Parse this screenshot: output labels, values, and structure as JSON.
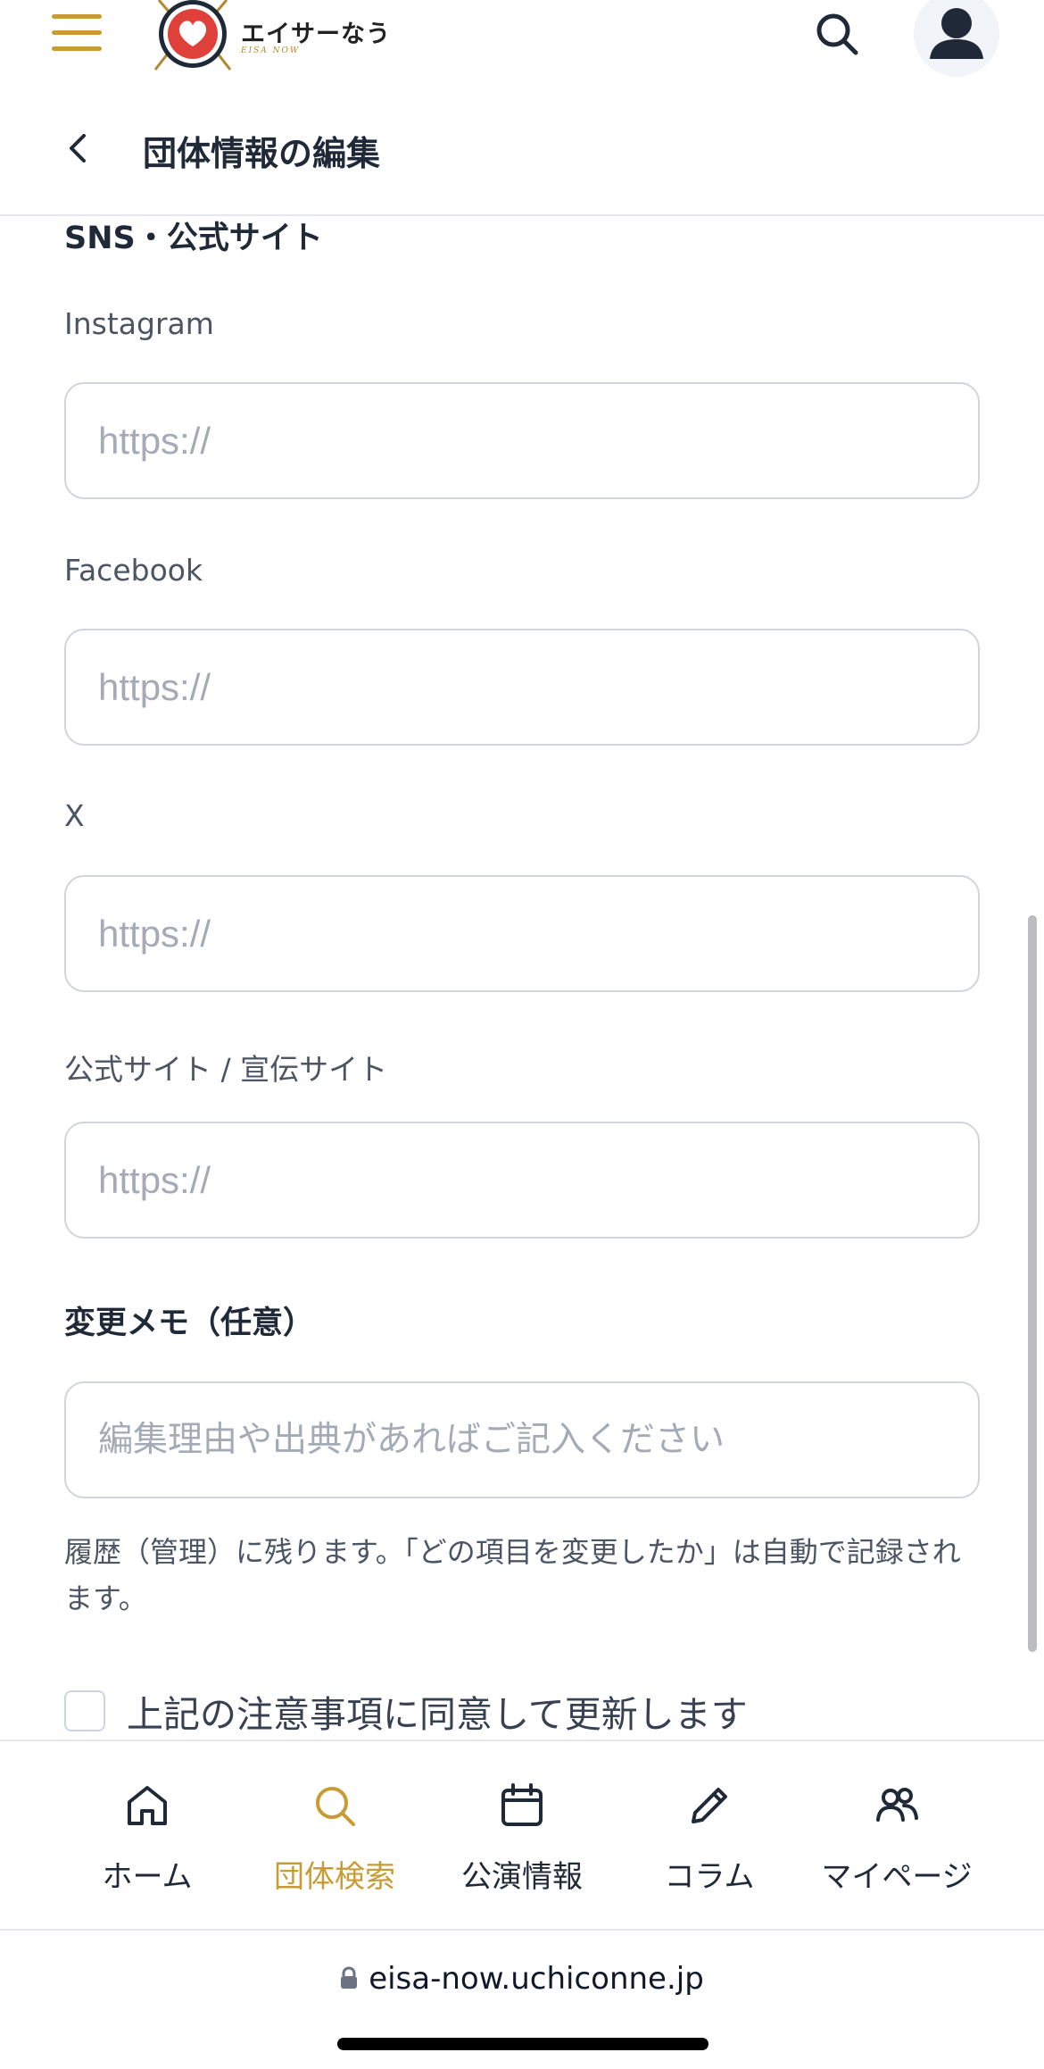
{
  "header": {
    "logo_title": "エイサーなう",
    "logo_subtitle": "EISA NOW",
    "page_title": "団体情報の編集"
  },
  "form": {
    "section_title": "SNS・公式サイト",
    "fields": [
      {
        "label": "Instagram",
        "value": "",
        "placeholder": "https://"
      },
      {
        "label": "Facebook",
        "value": "",
        "placeholder": "https://"
      },
      {
        "label": "X",
        "value": "",
        "placeholder": "https://"
      },
      {
        "label": "公式サイト / 宣伝サイト",
        "value": "",
        "placeholder": "https://"
      }
    ],
    "memo": {
      "label": "変更メモ（任意）",
      "value": "",
      "placeholder": "編集理由や出典があればご記入ください",
      "help": "履歴（管理）に残ります。「どの項目を変更したか」は自動で記録されます。"
    },
    "agree_label": "上記の注意事項に同意して更新します",
    "agree_checked": false
  },
  "tabs": [
    {
      "label": "ホーム",
      "icon": "home-icon",
      "active": false
    },
    {
      "label": "団体検索",
      "icon": "search-icon",
      "active": true
    },
    {
      "label": "公演情報",
      "icon": "calendar-icon",
      "active": false
    },
    {
      "label": "コラム",
      "icon": "pencil-icon",
      "active": false
    },
    {
      "label": "マイページ",
      "icon": "users-icon",
      "active": false
    }
  ],
  "browser": {
    "url": "eisa-now.uchiconne.jp"
  },
  "colors": {
    "accent": "#c89c35",
    "logo_red": "#e0403a",
    "text_primary": "#1f2937",
    "placeholder": "#a4abb6",
    "border": "#d1d5db"
  }
}
